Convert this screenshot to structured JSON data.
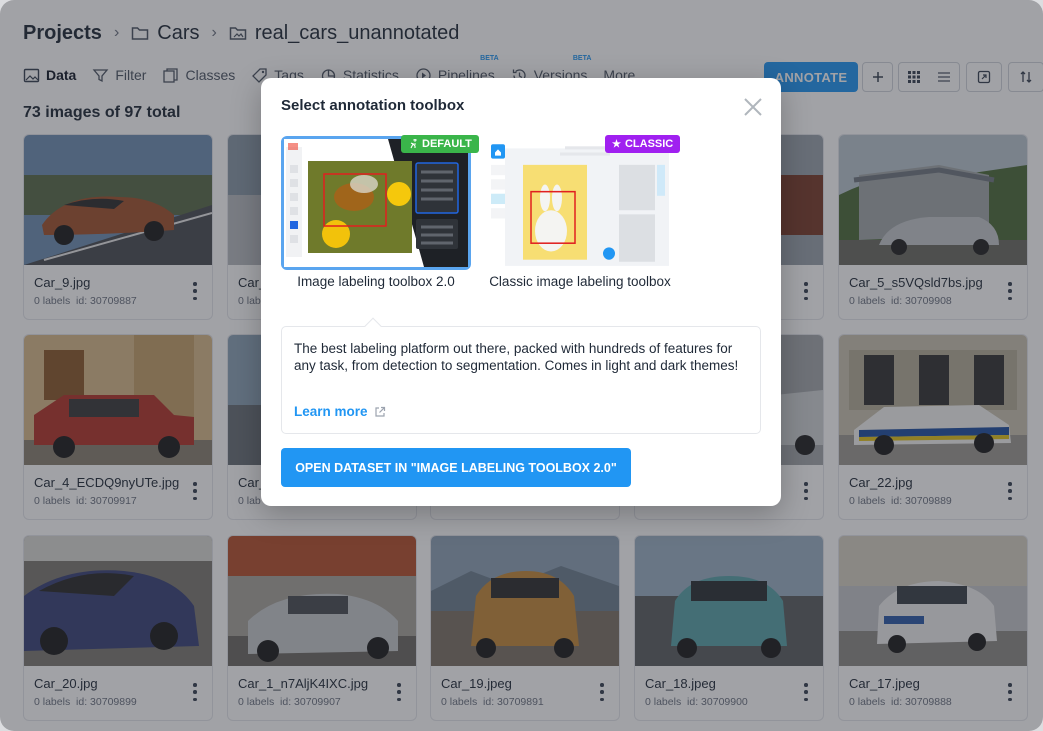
{
  "breadcrumb": {
    "root": "Projects",
    "project": "Cars",
    "dataset": "real_cars_unannotated"
  },
  "toolbar": {
    "tabs": [
      {
        "label": "Data",
        "icon": "image-icon",
        "active": true
      },
      {
        "label": "Filter",
        "icon": "filter-icon"
      },
      {
        "label": "Classes",
        "icon": "classes-icon"
      },
      {
        "label": "Tags",
        "icon": "tag-icon"
      },
      {
        "label": "Statistics",
        "icon": "chart-pie-icon"
      },
      {
        "label": "Pipelines",
        "icon": "play-circle-icon",
        "beta": "BETA"
      },
      {
        "label": "Versions",
        "icon": "history-icon",
        "beta": "BETA"
      },
      {
        "label": "More",
        "icon": ""
      }
    ],
    "annotate_label": "ANNOTATE"
  },
  "summary": "73 images of 97 total",
  "cards": [
    {
      "name": "Car_9.jpg",
      "labels": "0 labels",
      "id": "id: 30709887"
    },
    {
      "name": "Car_",
      "labels": "0 lab",
      "id": ""
    },
    {
      "name": "",
      "labels": "",
      "id": ""
    },
    {
      "name": "",
      "labels": "",
      "id": ""
    },
    {
      "name": "Car_5_s5VQsld7bs.jpg",
      "labels": "0 labels",
      "id": "id: 30709908"
    },
    {
      "name": "Car_4_ECDQ9nyUTe.jpg",
      "labels": "0 labels",
      "id": "id: 30709917"
    },
    {
      "name": "Car_",
      "labels": "0 lab",
      "id": ""
    },
    {
      "name": "",
      "labels": "",
      "id": ""
    },
    {
      "name": "",
      "labels": "",
      "id": ""
    },
    {
      "name": "Car_22.jpg",
      "labels": "0 labels",
      "id": "id: 30709889"
    },
    {
      "name": "Car_20.jpg",
      "labels": "0 labels",
      "id": "id: 30709899"
    },
    {
      "name": "Car_1_n7AljK4IXC.jpg",
      "labels": "0 labels",
      "id": "id: 30709907"
    },
    {
      "name": "Car_19.jpeg",
      "labels": "0 labels",
      "id": "id: 30709891"
    },
    {
      "name": "Car_18.jpeg",
      "labels": "0 labels",
      "id": "id: 30709900"
    },
    {
      "name": "Car_17.jpeg",
      "labels": "0 labels",
      "id": "id: 30709888"
    }
  ],
  "modal": {
    "title": "Select annotation toolbox",
    "options": [
      {
        "label": "Image labeling toolbox 2.0",
        "badge": "DEFAULT",
        "badge_color": "#3ab54a",
        "selected": true
      },
      {
        "label": "Classic image labeling toolbox",
        "badge": "CLASSIC",
        "badge_color": "#a020f0",
        "selected": false
      }
    ],
    "description": "The best labeling platform out there, packed with hundreds of features for any task, from detection to segmentation. Comes in light and dark themes!",
    "learn_more": "Learn more",
    "open_button": "OPEN DATASET IN \"IMAGE LABELING TOOLBOX 2.0\""
  },
  "colors": {
    "accent": "#2196f3",
    "overlay": "#282c34"
  }
}
